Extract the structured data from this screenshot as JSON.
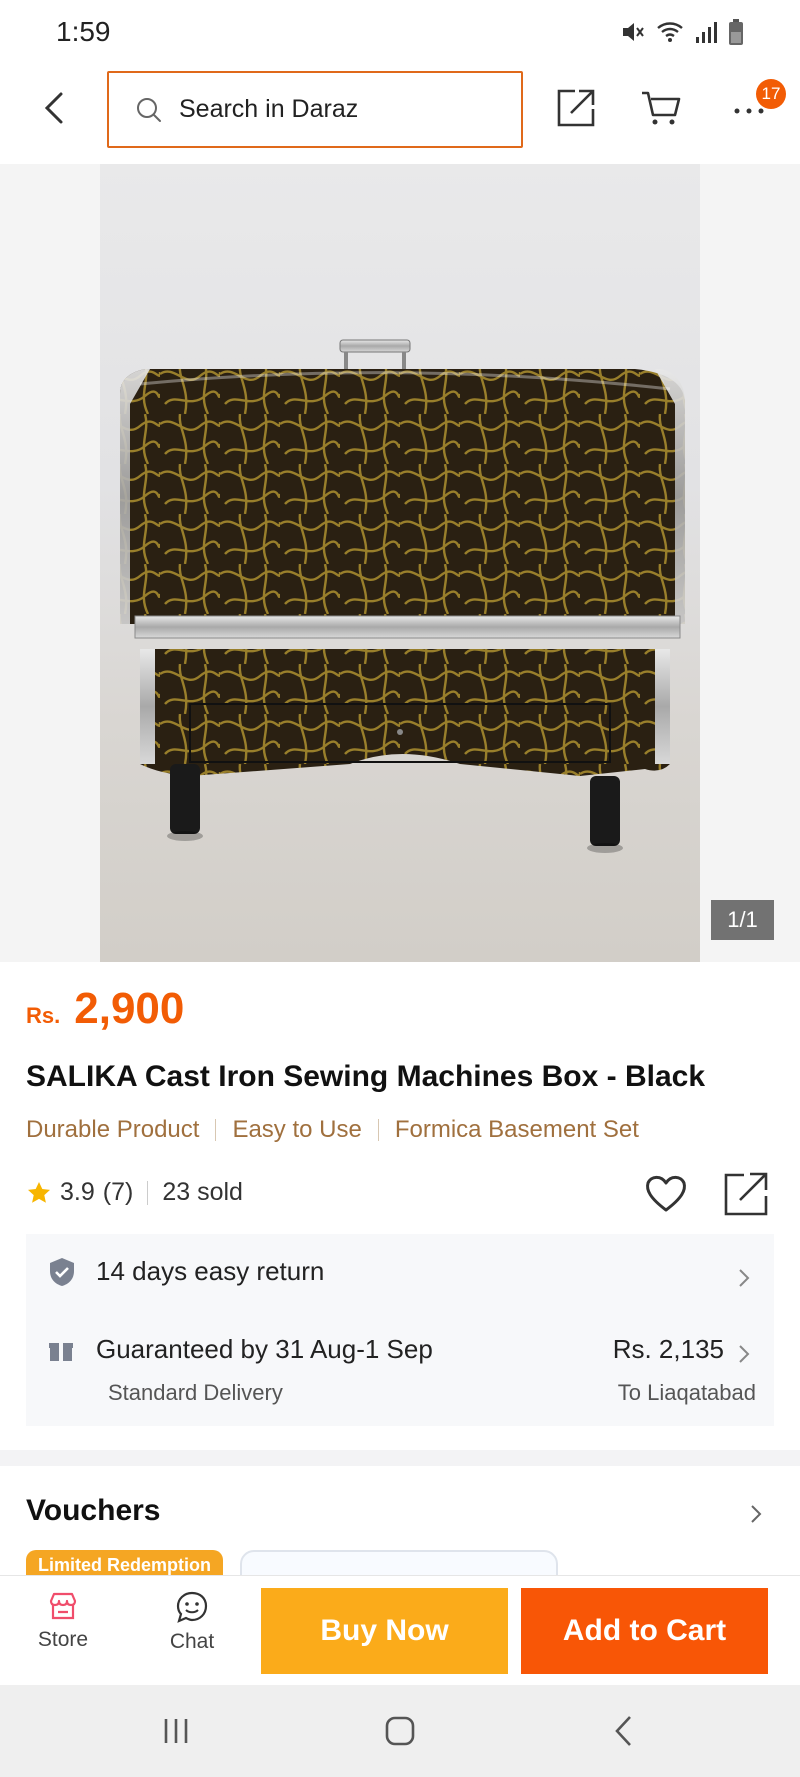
{
  "status_bar": {
    "time": "1:59"
  },
  "header": {
    "search_placeholder": "Search in Daraz",
    "more_badge": "17"
  },
  "gallery": {
    "counter": "1/1"
  },
  "product": {
    "currency": "Rs.",
    "price": "2,900",
    "title": "SALIKA Cast Iron Sewing Machines Box - Black",
    "tags": [
      "Durable Product",
      "Easy to Use",
      "Formica Basement Set"
    ],
    "rating": "3.9",
    "rating_count": "(7)",
    "sold": "23 sold"
  },
  "service": {
    "return_text": "14 days easy return",
    "delivery_text": "Guaranteed by 31 Aug-1 Sep",
    "delivery_type": "Standard Delivery",
    "delivery_price": "Rs. 2,135",
    "delivery_to": "To Liaqatabad"
  },
  "vouchers": {
    "title": "Vouchers",
    "limited_tag": "Limited Redemption"
  },
  "action_bar": {
    "store_label": "Store",
    "chat_label": "Chat",
    "buy_now_label": "Buy Now",
    "add_to_cart_label": "Add to Cart"
  },
  "colors": {
    "brand_orange": "#f85606",
    "buy_now_yellow": "#fbab1a",
    "price_orange": "#f25c05",
    "tag_brown": "#a0703e"
  }
}
